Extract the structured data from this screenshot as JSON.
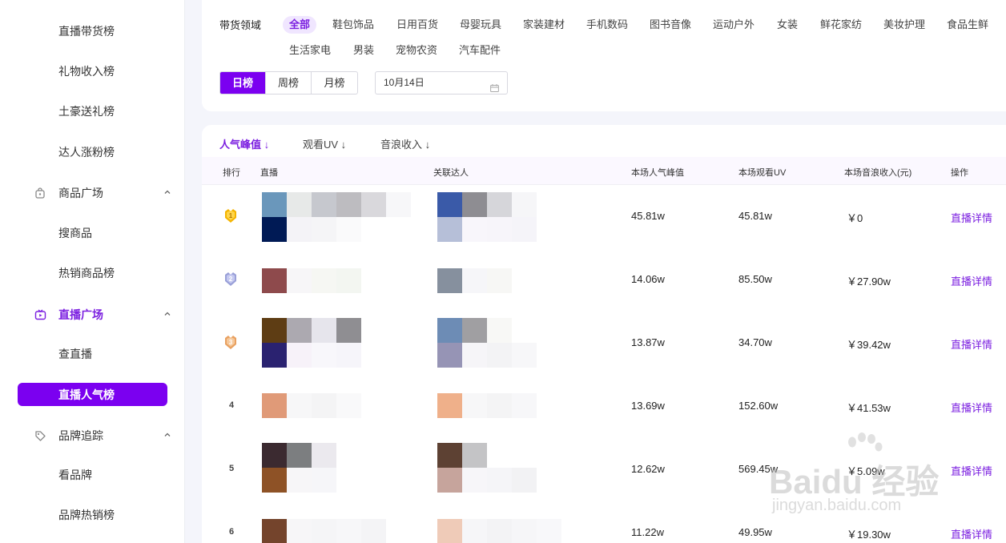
{
  "sidebar": {
    "items": [
      {
        "label": "直播带货榜",
        "kind": "sub"
      },
      {
        "label": "礼物收入榜",
        "kind": "sub"
      },
      {
        "label": "土豪送礼榜",
        "kind": "sub"
      },
      {
        "label": "达人涨粉榜",
        "kind": "sub"
      },
      {
        "label": "商品广场",
        "kind": "group",
        "icon": "shopping-bag-icon"
      },
      {
        "label": "搜商品",
        "kind": "sub"
      },
      {
        "label": "热销商品榜",
        "kind": "sub"
      },
      {
        "label": "直播广场",
        "kind": "group",
        "icon": "tv-icon",
        "active": true
      },
      {
        "label": "查直播",
        "kind": "sub"
      },
      {
        "label": "直播人气榜",
        "kind": "sub",
        "selected": true
      },
      {
        "label": "品牌追踪",
        "kind": "group",
        "icon": "tag-icon"
      },
      {
        "label": "看品牌",
        "kind": "sub"
      },
      {
        "label": "品牌热销榜",
        "kind": "sub"
      }
    ]
  },
  "filters": {
    "label": "带货领域",
    "categories": [
      "全部",
      "鞋包饰品",
      "日用百货",
      "母婴玩具",
      "家装建材",
      "手机数码",
      "图书音像",
      "运动户外",
      "女装",
      "鲜花家纺",
      "美妆护理",
      "食品生鲜",
      "生活家电",
      "男装",
      "宠物农资",
      "汽车配件"
    ],
    "active_category": "全部",
    "periods": [
      "日榜",
      "周榜",
      "月榜"
    ],
    "active_period": "日榜",
    "date_value": "10月14日"
  },
  "sort_tabs": [
    "人气峰值 ↓",
    "观看UV ↓",
    "音浪收入 ↓"
  ],
  "table": {
    "headers": [
      "排行",
      "直播",
      "关联达人",
      "本场人气峰值",
      "本场观看UV",
      "本场音浪收入(元)",
      "操作"
    ],
    "rows": [
      {
        "rank": "1",
        "peak": "45.81w",
        "uv": "45.81w",
        "income": "￥0",
        "action": "直播详情"
      },
      {
        "rank": "2",
        "peak": "14.06w",
        "uv": "85.50w",
        "income": "￥27.90w",
        "action": "直播详情"
      },
      {
        "rank": "3",
        "peak": "13.87w",
        "uv": "34.70w",
        "income": "￥39.42w",
        "action": "直播详情"
      },
      {
        "rank": "4",
        "peak": "13.69w",
        "uv": "152.60w",
        "income": "￥41.53w",
        "action": "直播详情"
      },
      {
        "rank": "5",
        "peak": "12.62w",
        "uv": "569.45w",
        "income": "￥5.09w",
        "action": "直播详情"
      },
      {
        "rank": "6",
        "peak": "11.22w",
        "uv": "49.95w",
        "income": "￥19.30w",
        "action": "直播详情"
      }
    ]
  },
  "watermark": {
    "brand": "Baidu 经验",
    "url": "jingyan.baidu.com"
  },
  "colors": {
    "accent": "#7b00f0",
    "accent_text": "#7b1fe0",
    "gold_medal": "#f4b400",
    "silver_medal": "#9aa0d8",
    "bronze_medal": "#e8a060"
  }
}
